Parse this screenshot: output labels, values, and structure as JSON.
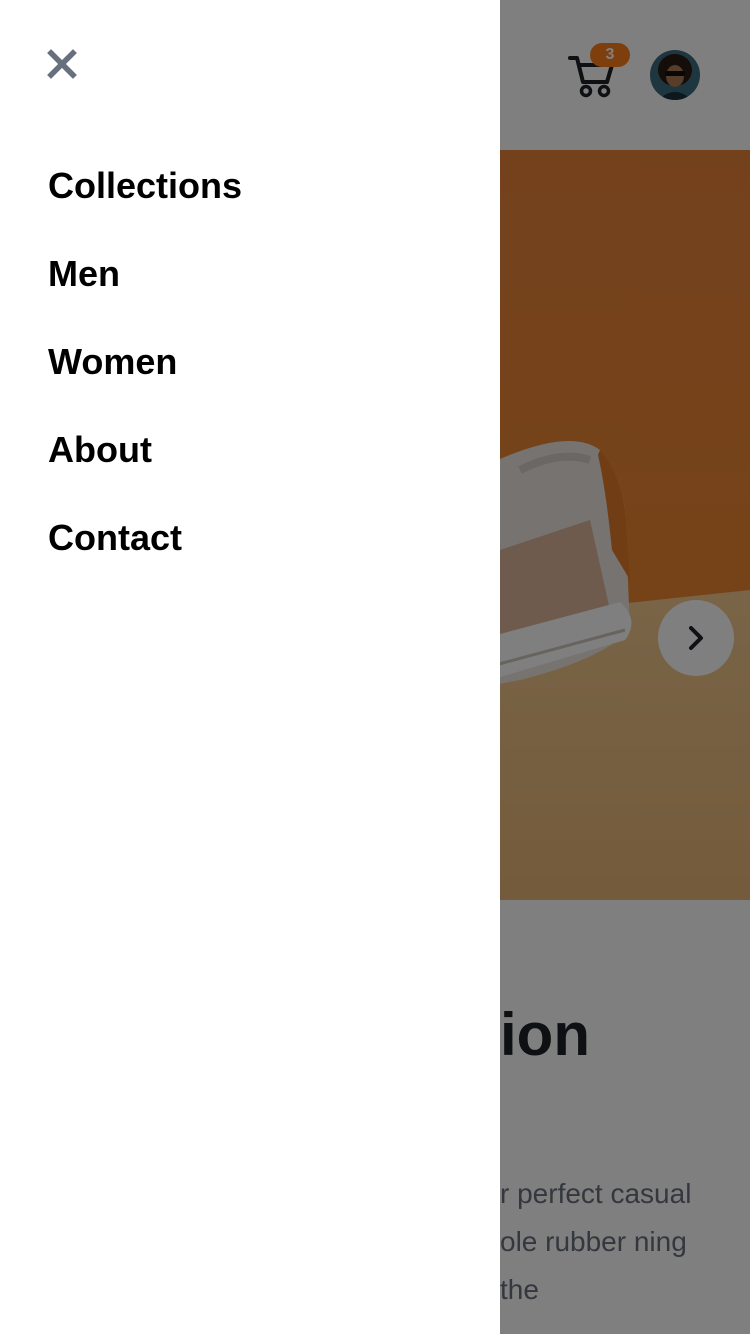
{
  "colors": {
    "accent": "#ff7e1b",
    "text_dark": "#1d2026",
    "text_muted": "#68707d",
    "overlay": "rgba(0,0,0,0.5)",
    "close_icon": "#68707d"
  },
  "header": {
    "cart": {
      "icon": "cart-icon",
      "count": "3"
    },
    "avatar": {
      "icon": "avatar"
    }
  },
  "nav": {
    "close_icon": "close-icon",
    "items": [
      {
        "label": "Collections"
      },
      {
        "label": "Men"
      },
      {
        "label": "Women"
      },
      {
        "label": "About"
      },
      {
        "label": "Contact"
      }
    ]
  },
  "hero": {
    "next_icon": "chevron-right-icon"
  },
  "product": {
    "title_visible": "ion",
    "description_visible": "r perfect casual ole rubber ning the"
  }
}
